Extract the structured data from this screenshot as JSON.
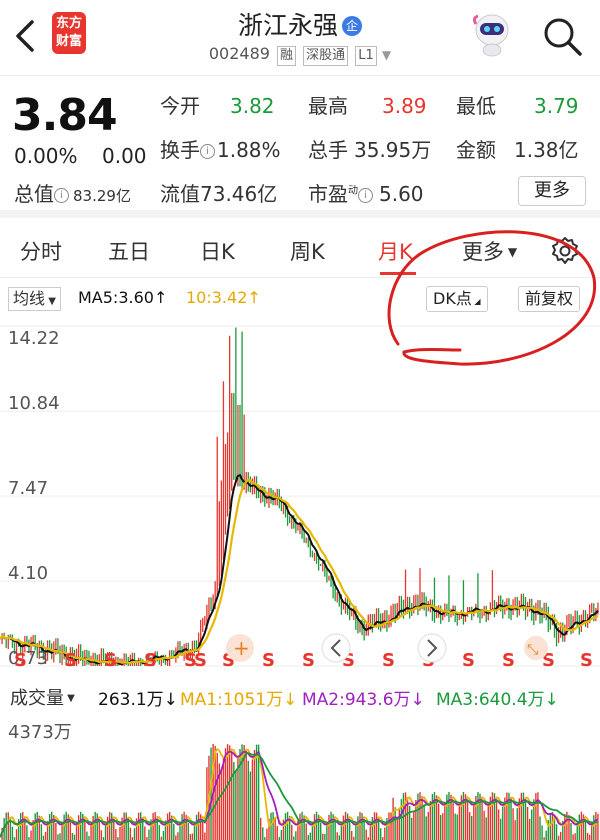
{
  "header": {
    "logo_text": "东方财富",
    "title": "浙江永强",
    "title_badge": "企",
    "code": "002489",
    "tags": [
      "融",
      "深股通",
      "L1"
    ],
    "back_icon": "chevron-left-icon",
    "robot_icon": "robot-assistant-icon",
    "search_icon": "search-icon"
  },
  "quote": {
    "price": "3.84",
    "change_pct": "0.00%",
    "change_abs": "0.00",
    "open_label": "今开",
    "open": "3.82",
    "high_label": "最高",
    "high": "3.89",
    "low_label": "最低",
    "low": "3.79",
    "turnover_label": "换手",
    "turnover": "1.88%",
    "volume_label": "总手",
    "volume": "35.95万",
    "amount_label": "金额",
    "amount": "1.38亿",
    "mktcap_label": "总值",
    "mktcap": "83.29亿",
    "float_label": "流值",
    "float_cap": "73.46亿",
    "pe_label": "市盈",
    "pe_sup": "动",
    "pe": "5.60",
    "more_label": "更多"
  },
  "tabs": {
    "items": [
      "分时",
      "五日",
      "日K",
      "周K",
      "月K",
      "更多"
    ],
    "active": "月K",
    "settings_icon": "gear-icon"
  },
  "chart_toolbar": {
    "indicator": "均线",
    "ma5": "MA5:3.60",
    "ma10": "10:3.42",
    "dk_label": "DK点",
    "adjust_label": "前复权"
  },
  "kline": {
    "y_labels": [
      "14.22",
      "10.84",
      "7.47",
      "4.10",
      "0.73"
    ],
    "signal": "S"
  },
  "volume_toolbar": {
    "label": "成交量",
    "vol": "263.1万",
    "ma1": "MA1:1051万",
    "ma2": "MA2:943.6万",
    "ma3": "MA3:640.4万",
    "max_label": "4373万"
  },
  "colors": {
    "up": "#e8352d",
    "down": "#1a9a3a",
    "ma5": "#111111",
    "ma10": "#e6b800",
    "ma2": "#a020c0",
    "ma3": "#1a9a3a"
  }
}
